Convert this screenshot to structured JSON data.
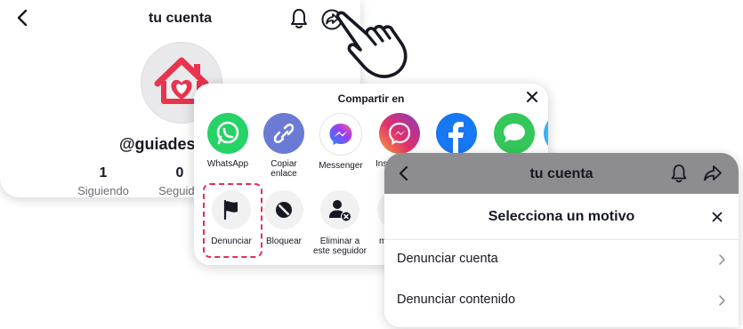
{
  "profile_screen": {
    "title": "tu cuenta",
    "handle": "@guiadese",
    "stats": [
      {
        "value": "1",
        "label": "Siguiendo"
      },
      {
        "value": "0",
        "label": "Seguido"
      }
    ]
  },
  "share_sheet": {
    "title": "Compartir en",
    "apps": [
      {
        "label": "WhatsApp",
        "color": "#25d366",
        "icon": "whatsapp-icon"
      },
      {
        "label": "Copiar\nenlace",
        "color": "#6b7bd4",
        "icon": "link-icon"
      },
      {
        "label": "Messenger",
        "color": "#ffffff",
        "icon": "messenger-icon"
      },
      {
        "label": "Ins",
        "color": "#c13584",
        "icon": "instagram-messenger-icon"
      },
      {
        "label": "",
        "color": "#1877f2",
        "icon": "facebook-icon"
      },
      {
        "label": "",
        "color": "#34c759",
        "icon": "message-icon"
      }
    ],
    "actions": [
      {
        "label": "Denunciar",
        "icon": "flag-icon"
      },
      {
        "label": "Bloquear",
        "icon": "block-icon"
      },
      {
        "label": "Eliminar a\neste seguidor",
        "icon": "remove-follower-icon"
      },
      {
        "label": "m",
        "icon": "more-icon"
      }
    ]
  },
  "report_screen": {
    "header_title": "tu cuenta",
    "sheet_title": "Selecciona un motivo",
    "options": [
      "Denunciar cuenta",
      "Denunciar contenido"
    ]
  },
  "colors": {
    "highlight": "#e2305a",
    "brand_red": "#e8344e"
  }
}
